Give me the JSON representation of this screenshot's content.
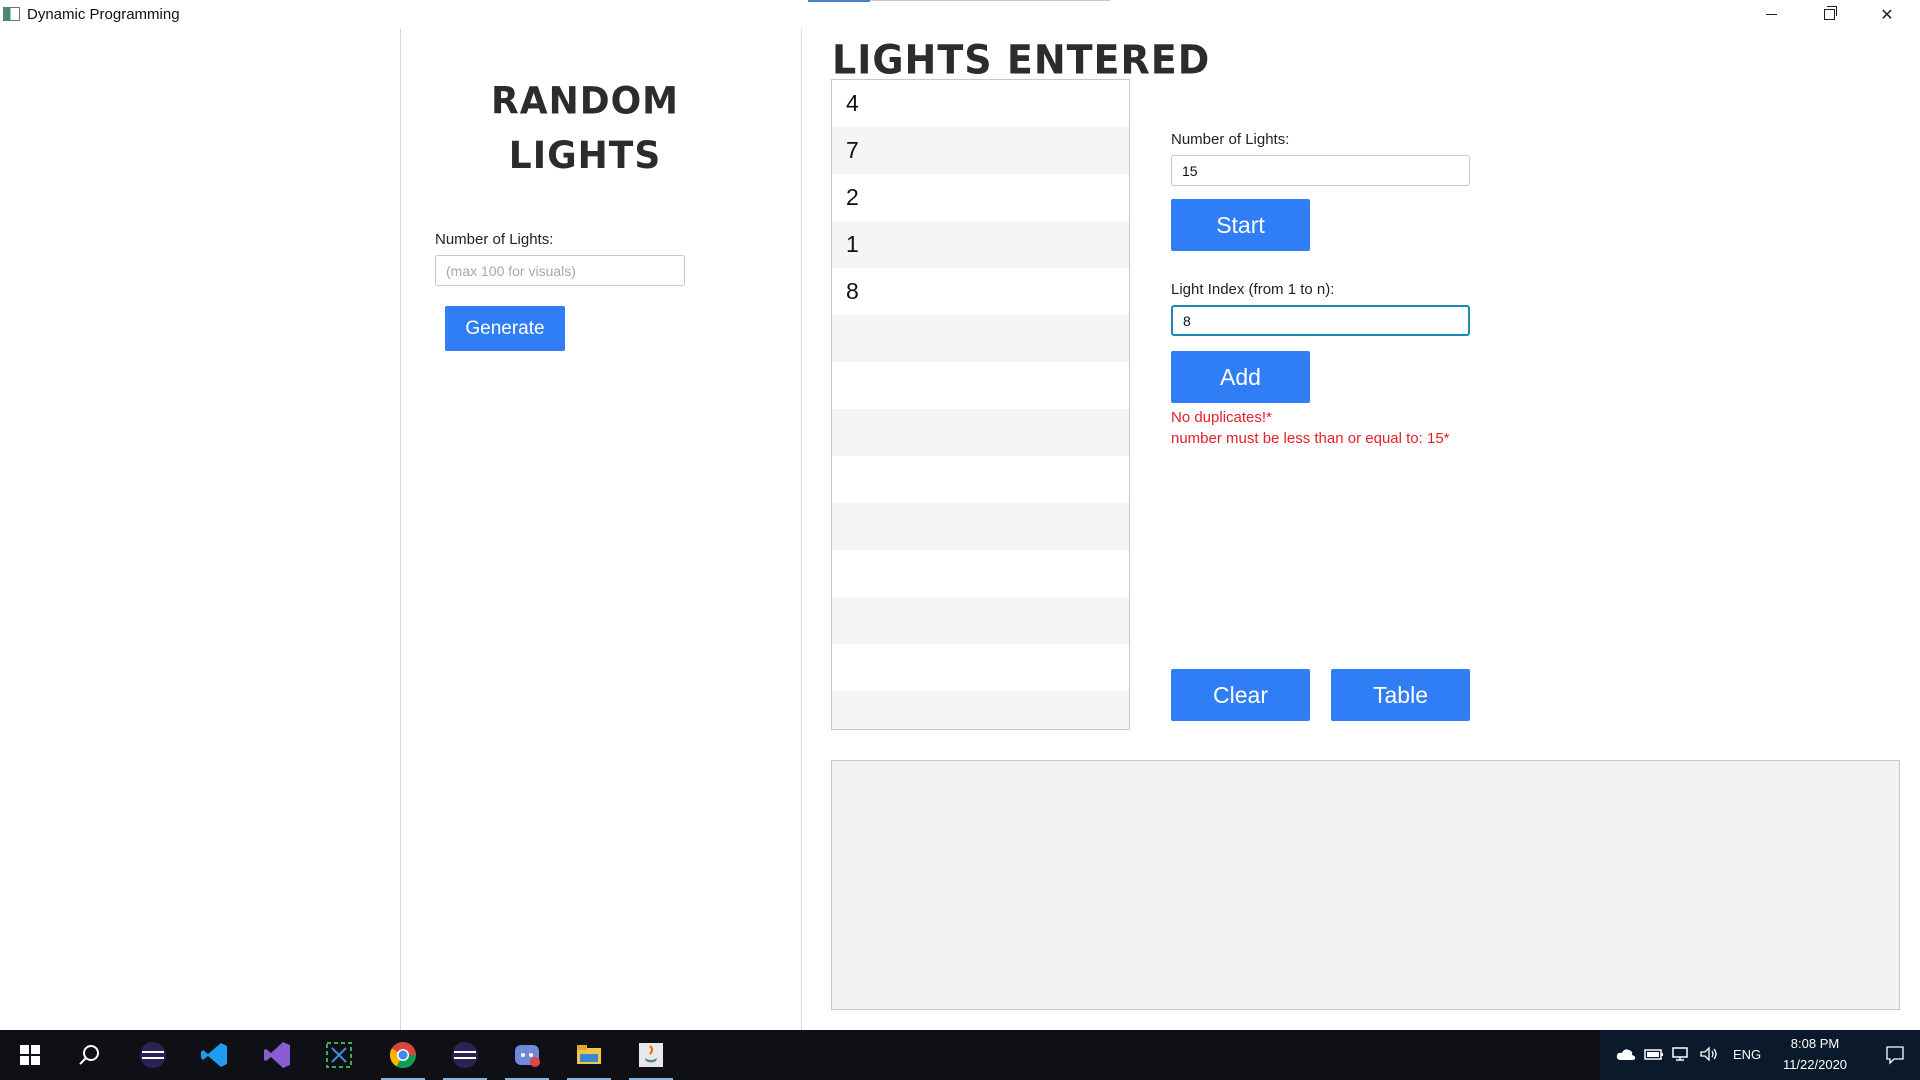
{
  "window": {
    "title": "Dynamic Programming"
  },
  "random": {
    "title_line1": "Random",
    "title_line2": "Lights",
    "number_label": "Number of Lights:",
    "number_placeholder": "(max 100 for visuals)",
    "generate_label": "Generate"
  },
  "lights": {
    "title": "Lights Entered",
    "entries": [
      "4",
      "7",
      "2",
      "1",
      "8"
    ]
  },
  "controls": {
    "number_label": "Number of Lights:",
    "number_value": "15",
    "start_label": "Start",
    "index_label": "Light Index (from 1 to n):",
    "index_value": "8",
    "add_label": "Add",
    "error_duplicates": "No duplicates!*",
    "error_range": "number must be less than or equal to: 15*",
    "clear_label": "Clear",
    "table_label": "Table"
  },
  "taskbar": {
    "apps": [
      "windows-start-icon",
      "search-icon",
      "eclipse-icon",
      "vscode-icon",
      "visual-studio-icon",
      "snip-tool-icon",
      "chrome-icon",
      "eclipse-icon-2",
      "discord-icon",
      "file-explorer-icon",
      "java-icon"
    ],
    "language": "ENG",
    "time": "8:08 PM",
    "date": "11/22/2020"
  }
}
